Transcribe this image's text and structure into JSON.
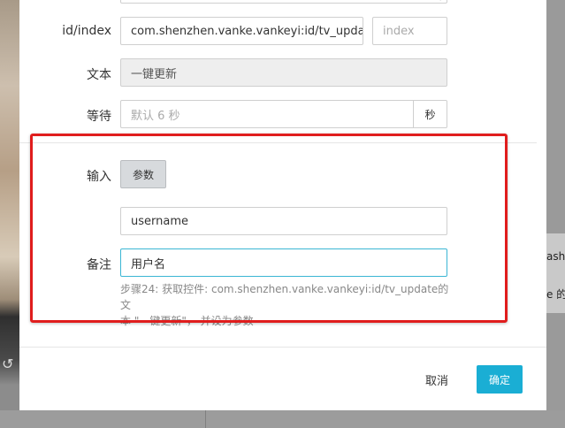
{
  "form": {
    "id_label": "id/index",
    "id_value": "com.shenzhen.vanke.vankeyi:id/tv_update",
    "index_placeholder": "index",
    "text_label": "文本",
    "text_value": "一键更新",
    "wait_label": "等待",
    "wait_placeholder": "默认 6 秒",
    "wait_unit": "秒",
    "input_label": "输入",
    "param_button": "参数",
    "param_value": "username",
    "remark_label": "备注",
    "remark_value": "用户名",
    "hint_line1": "步骤24: 获取控件: com.shenzhen.vanke.vankeyi:id/tv_update的文",
    "hint_line2": "本 \"一键更新\"， 并设为参数"
  },
  "footer": {
    "cancel_label": "取消",
    "ok_label": "确定"
  },
  "background": {
    "right_text_1": "ash",
    "right_text_2": "e 的"
  },
  "colors": {
    "highlight": "#e01d1d",
    "primary": "#1aaed4",
    "focus": "#3bb6d4"
  }
}
